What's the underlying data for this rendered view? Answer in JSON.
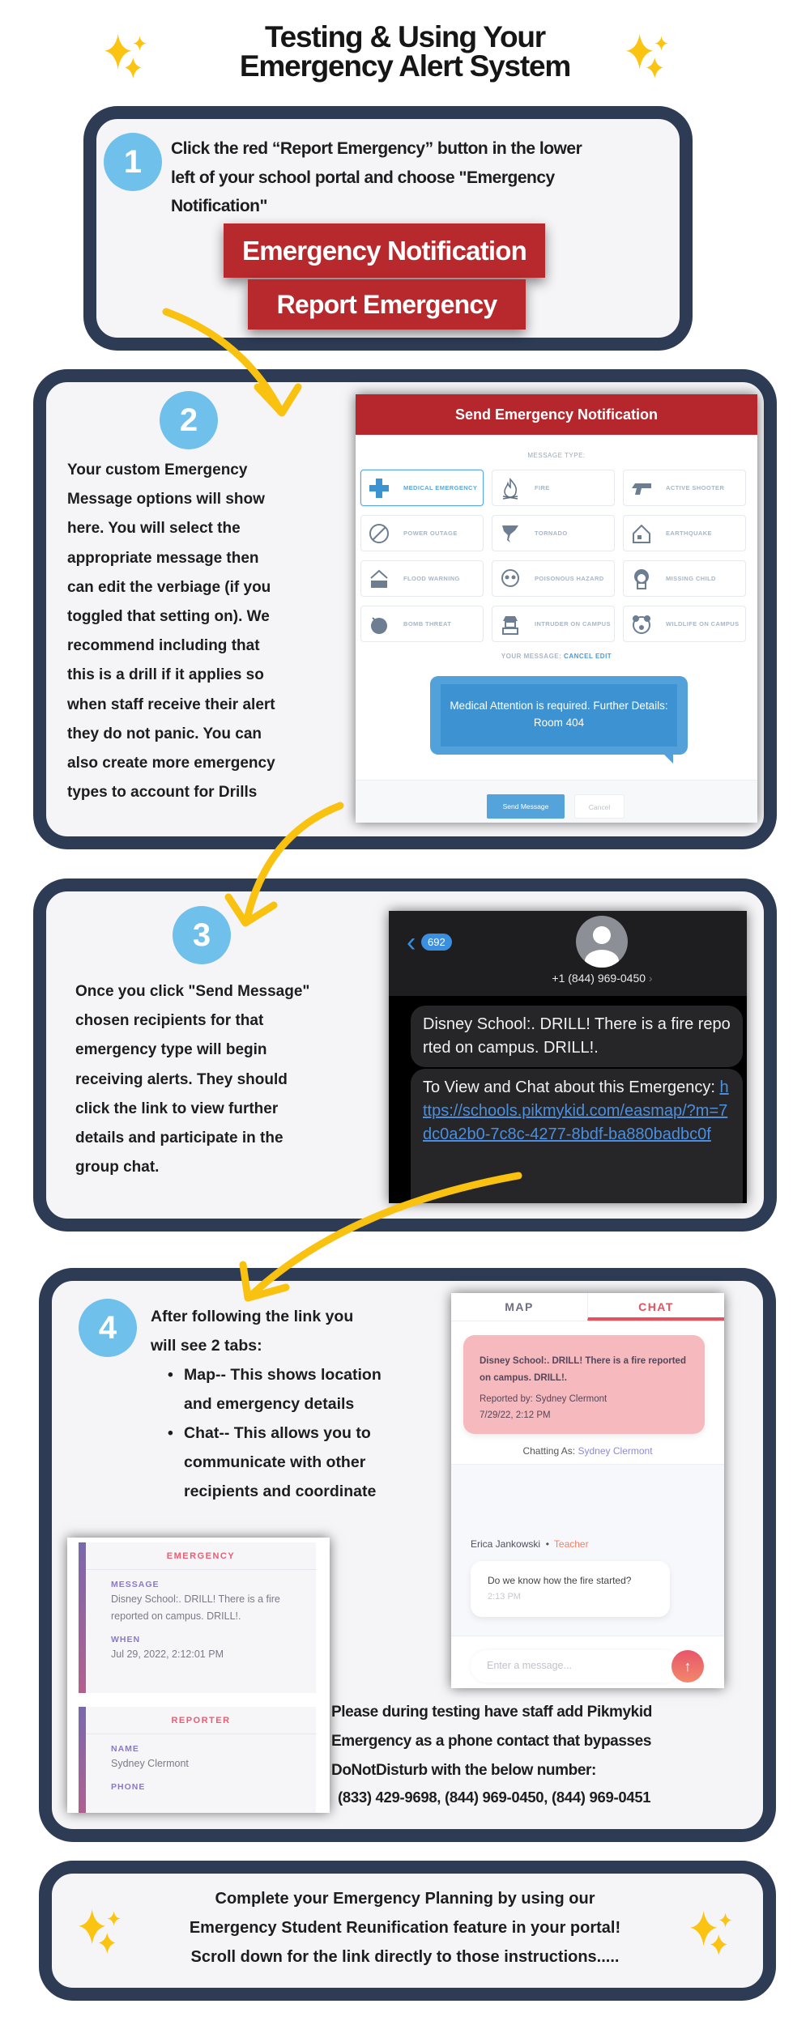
{
  "title": {
    "lines": [
      "Testing & Using Your",
      "Emergency Alert System"
    ]
  },
  "colors": {
    "border": "#2d3b55",
    "step_circle": "#6fc0eb",
    "red_button": "#b8292d",
    "arrow": "#f9c110",
    "sparkle": "#fbc413"
  },
  "step1": {
    "number": "1",
    "lines": [
      "Click the red “Report Emergency” button in the lower",
      "left of your school portal and choose \"Emergency",
      "Notification\""
    ],
    "buttons": {
      "emergency_notification": "Emergency Notification",
      "report_emergency": "Report Emergency"
    }
  },
  "step2": {
    "number": "2",
    "lines": [
      "Your custom Emergency",
      "Message options will show",
      "here. You will select the",
      "appropriate message then",
      "can edit the verbiage (if you",
      "toggled that setting on). We",
      "recommend including that",
      "this is a drill if it applies so",
      "when staff receive their alert",
      "they do not panic. You can",
      "also create more emergency",
      "types to account for Drills"
    ],
    "screenshot": {
      "header": "Send Emergency Notification",
      "message_type_label": "MESSAGE TYPE:",
      "types": [
        {
          "label": "MEDICAL EMERGENCY",
          "icon": "medical-cross-icon",
          "selected": true
        },
        {
          "label": "FIRE",
          "icon": "fire-icon"
        },
        {
          "label": "ACTIVE SHOOTER",
          "icon": "gun-icon"
        },
        {
          "label": "POWER OUTAGE",
          "icon": "power-outage-icon"
        },
        {
          "label": "TORNADO",
          "icon": "tornado-icon"
        },
        {
          "label": "EARTHQUAKE",
          "icon": "earthquake-house-icon"
        },
        {
          "label": "FLOOD WARNING",
          "icon": "flood-house-icon"
        },
        {
          "label": "POISONOUS HAZARD",
          "icon": "skull-icon"
        },
        {
          "label": "MISSING CHILD",
          "icon": "child-icon"
        },
        {
          "label": "BOMB THREAT",
          "icon": "bomb-icon"
        },
        {
          "label": "INTRUDER ON CAMPUS",
          "icon": "intruder-icon"
        },
        {
          "label": "WILDLIFE ON CAMPUS",
          "icon": "bear-icon"
        }
      ],
      "your_message_label": "YOUR MESSAGE:",
      "cancel_edit": "CANCEL EDIT",
      "message": "Medical Attention is required. Further Details: Room 404",
      "send_button": "Send Message",
      "cancel_button": "Cancel"
    }
  },
  "step3": {
    "number": "3",
    "lines": [
      "Once you click \"Send Message\"",
      "chosen recipients for that",
      "emergency type will begin",
      "receiving alerts. They should",
      "click the link to view further",
      "details and participate in the",
      "group chat."
    ],
    "phone": {
      "back_count": "692",
      "contact": "+1 (844) 969-0450",
      "message1": "Disney School:. DRILL! There is a fire reported on campus. DRILL!.",
      "message2_text": "To View and Chat about this Emergency: ",
      "message2_link": "https://schools.pikmykid.com/easmap/?m=7dc0a2b0-7c8c-4277-8bdf-ba880badbc0f"
    }
  },
  "step4": {
    "number": "4",
    "intro_lines": [
      "After following the link you",
      "will see 2 tabs:"
    ],
    "bullets": [
      {
        "lines": [
          "Map-- This shows location",
          "and emergency details"
        ]
      },
      {
        "lines": [
          "Chat-- This allows you to",
          "communicate with other",
          "recipients and coordinate"
        ]
      }
    ],
    "chat": {
      "tabs": [
        "MAP",
        "CHAT"
      ],
      "active_tab": "CHAT",
      "alert_text": "Disney School:. DRILL! There is a fire reported on campus. DRILL!.",
      "reported_by": "Reported by: Sydney Clermont",
      "alert_time": "7/29/22, 2:12 PM",
      "chatting_as_label": "Chatting As:",
      "chatting_as_name": "Sydney Clermont",
      "sender": "Erica Jankowski",
      "sender_role": "Teacher",
      "message": "Do we know how the fire started?",
      "message_time": "2:13 PM",
      "input_placeholder": "Enter a message..."
    },
    "card": {
      "emergency_header": "EMERGENCY",
      "message_label": "MESSAGE",
      "message_value": "Disney School:. DRILL! There is a fire reported on campus. DRILL!.",
      "when_label": "WHEN",
      "when_value": "Jul 29, 2022, 2:12:01 PM",
      "reporter_header": "REPORTER",
      "name_label": "NAME",
      "name_value": "Sydney Clermont",
      "phone_label": "PHONE"
    },
    "note_lines": [
      "Please during testing have staff add Pikmykid",
      "Emergency as a phone contact that bypasses",
      "DoNotDisturb with the below number:"
    ],
    "numbers": "(833) 429-9698, (844) 969-0450, (844) 969-0451"
  },
  "closing": {
    "lines": [
      "Complete your Emergency Planning by using our",
      "Emergency Student Reunification feature in your portal!",
      "Scroll down for the link directly to those instructions....."
    ]
  }
}
